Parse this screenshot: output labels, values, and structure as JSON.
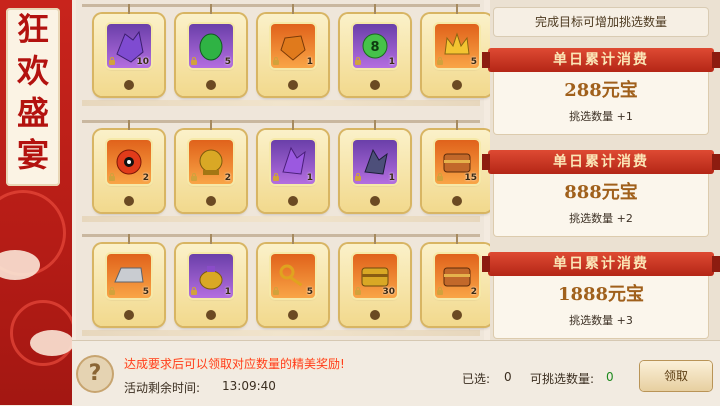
{
  "banner": {
    "title_chars": [
      "狂",
      "欢",
      "盛",
      "宴"
    ]
  },
  "grid": {
    "rows": [
      [
        {
          "item": "purple-crystal-icon",
          "count": "10",
          "slot": "purple"
        },
        {
          "item": "green-jade-icon",
          "count": "5",
          "slot": "purple"
        },
        {
          "item": "amber-stone-icon",
          "count": "1",
          "slot": "orange"
        },
        {
          "item": "green-orb-icon",
          "count": "1",
          "slot": "purple"
        },
        {
          "item": "gold-crown-icon",
          "count": "5",
          "slot": "orange"
        }
      ],
      [
        {
          "item": "fire-orb-icon",
          "count": "2",
          "slot": "orange"
        },
        {
          "item": "gold-orb-icon",
          "count": "2",
          "slot": "orange"
        },
        {
          "item": "violet-crystal-icon",
          "count": "1",
          "slot": "purple"
        },
        {
          "item": "dark-crystal-icon",
          "count": "1",
          "slot": "purple"
        },
        {
          "item": "treasure-chest-icon",
          "count": "15",
          "slot": "orange"
        }
      ],
      [
        {
          "item": "silver-ingot-icon",
          "count": "5",
          "slot": "orange"
        },
        {
          "item": "gold-pouch-icon",
          "count": "1",
          "slot": "purple"
        },
        {
          "item": "gold-key-icon",
          "count": "5",
          "slot": "orange"
        },
        {
          "item": "gold-chest-icon",
          "count": "30",
          "slot": "orange"
        },
        {
          "item": "treasure-chest-icon",
          "count": "2",
          "slot": "orange"
        }
      ]
    ]
  },
  "right": {
    "hint": "完成目标可增加挑选数量",
    "tiers": [
      {
        "title": "单日累计消费",
        "amount": "288元宝",
        "bonus": "挑选数量 +1"
      },
      {
        "title": "单日累计消费",
        "amount": "888元宝",
        "bonus": "挑选数量 +2"
      },
      {
        "title": "单日累计消费",
        "amount": "1888元宝",
        "bonus": "挑选数量 +3"
      }
    ]
  },
  "bottom": {
    "requirement": "达成要求后可以领取对应数量的精美奖励!",
    "timer_label": "活动剩余时间:",
    "timer_value": "13:09:40",
    "selected_label": "已选:",
    "selected_value": "0",
    "pickable_label": "可挑选数量:",
    "pickable_value": "0",
    "claim_label": "领取",
    "help_symbol": "?"
  },
  "colors": {
    "accent_red": "#b42616",
    "gold": "#d8b563",
    "count_green": "#1f8a1f",
    "requirement_red": "#ff3b1d"
  }
}
